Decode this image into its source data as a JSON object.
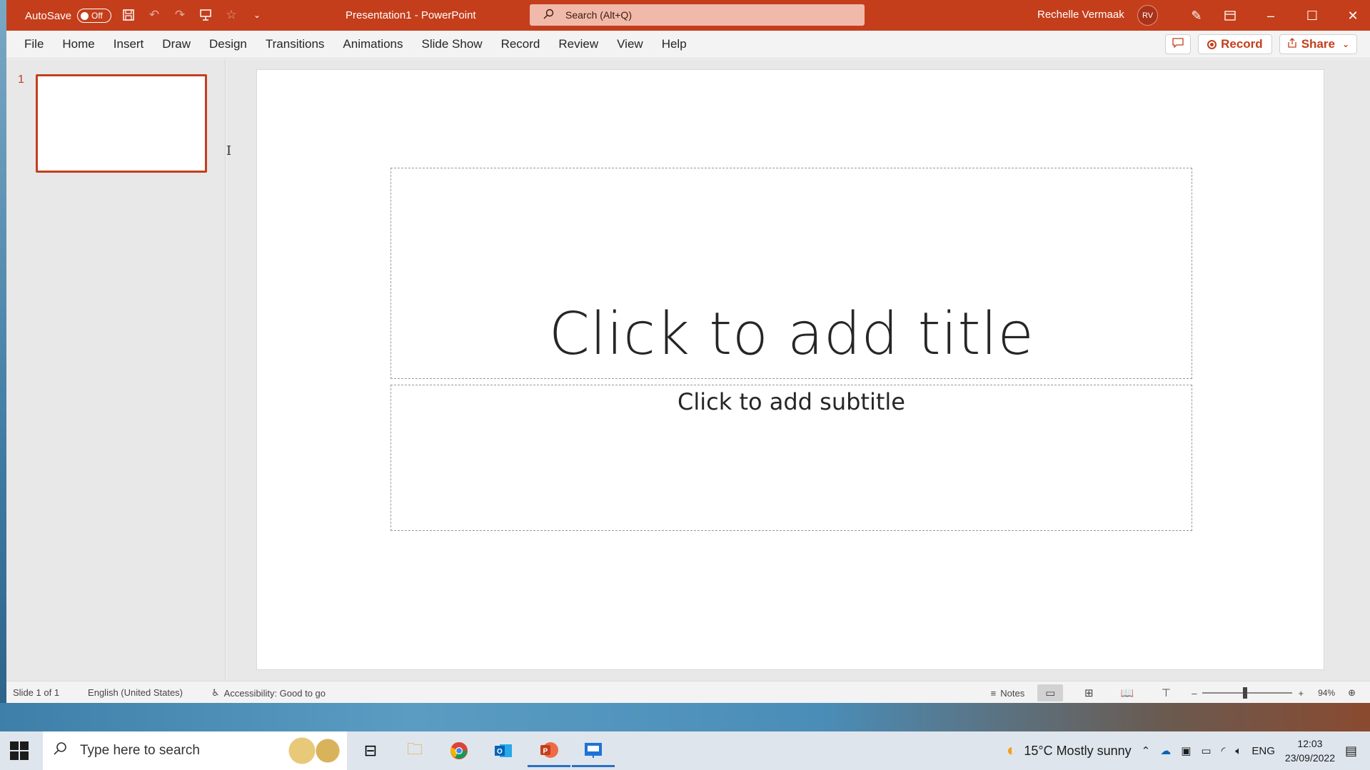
{
  "window": {
    "autosave_label": "AutoSave",
    "autosave_state": "Off",
    "doc_title": "Presentation1  -  PowerPoint",
    "search_placeholder": "Search (Alt+Q)",
    "user_name": "Rechelle Vermaak",
    "user_initials": "RV"
  },
  "ribbon": {
    "tabs": [
      "File",
      "Home",
      "Insert",
      "Draw",
      "Design",
      "Transitions",
      "Animations",
      "Slide Show",
      "Record",
      "Review",
      "View",
      "Help"
    ],
    "record_label": "Record",
    "share_label": "Share"
  },
  "thumbnails": {
    "slide_number": "1"
  },
  "slide": {
    "title_placeholder": "Click to add title",
    "subtitle_placeholder": "Click to add subtitle"
  },
  "statusbar": {
    "slide_info": "Slide 1 of 1",
    "language": "English (United States)",
    "accessibility": "Accessibility: Good to go",
    "notes_label": "Notes",
    "zoom_level": "94%"
  },
  "taskbar": {
    "search_placeholder": "Type here to search",
    "weather": "15°C  Mostly sunny",
    "language": "ENG",
    "time": "12:03",
    "date": "23/09/2022"
  },
  "colors": {
    "brand": "#c43e1c",
    "search_bg": "#f1b9a9"
  }
}
